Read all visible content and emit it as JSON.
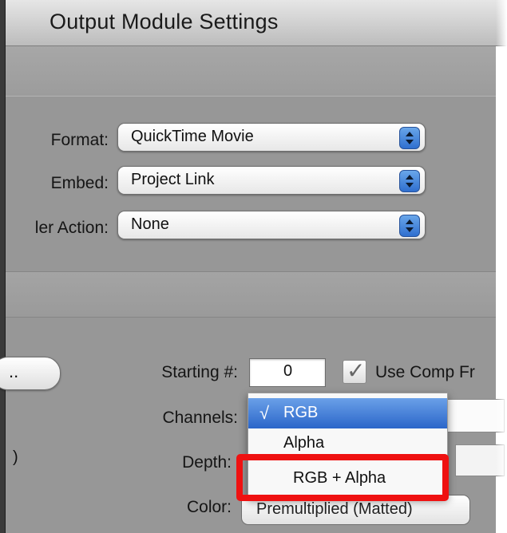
{
  "window": {
    "title": "Output Module Settings"
  },
  "fields": {
    "format_label": "Format:",
    "format_value": "QuickTime Movie",
    "embed_label": "Embed:",
    "embed_value": "Project Link",
    "post_render_label": "ler Action:",
    "post_render_value": "None",
    "starting_label": "Starting #:",
    "starting_value": "0",
    "use_comp_label": "Use Comp Fr",
    "channels_label": "Channels:",
    "depth_label": "Depth:",
    "color_label": "Color:",
    "color_value": "Premultiplied (Matted)",
    "button_label": "..",
    "paren": ")",
    "check_mark": "✓"
  },
  "channels_menu": {
    "items": [
      {
        "check": "√",
        "label": "RGB",
        "selected": true
      },
      {
        "check": "",
        "label": "Alpha",
        "selected": false
      },
      {
        "check": "",
        "label": "RGB + Alpha",
        "selected": false
      }
    ]
  },
  "colors": {
    "accent": "#2b66c9",
    "highlight": "#ef1111",
    "panel": "#979797"
  }
}
